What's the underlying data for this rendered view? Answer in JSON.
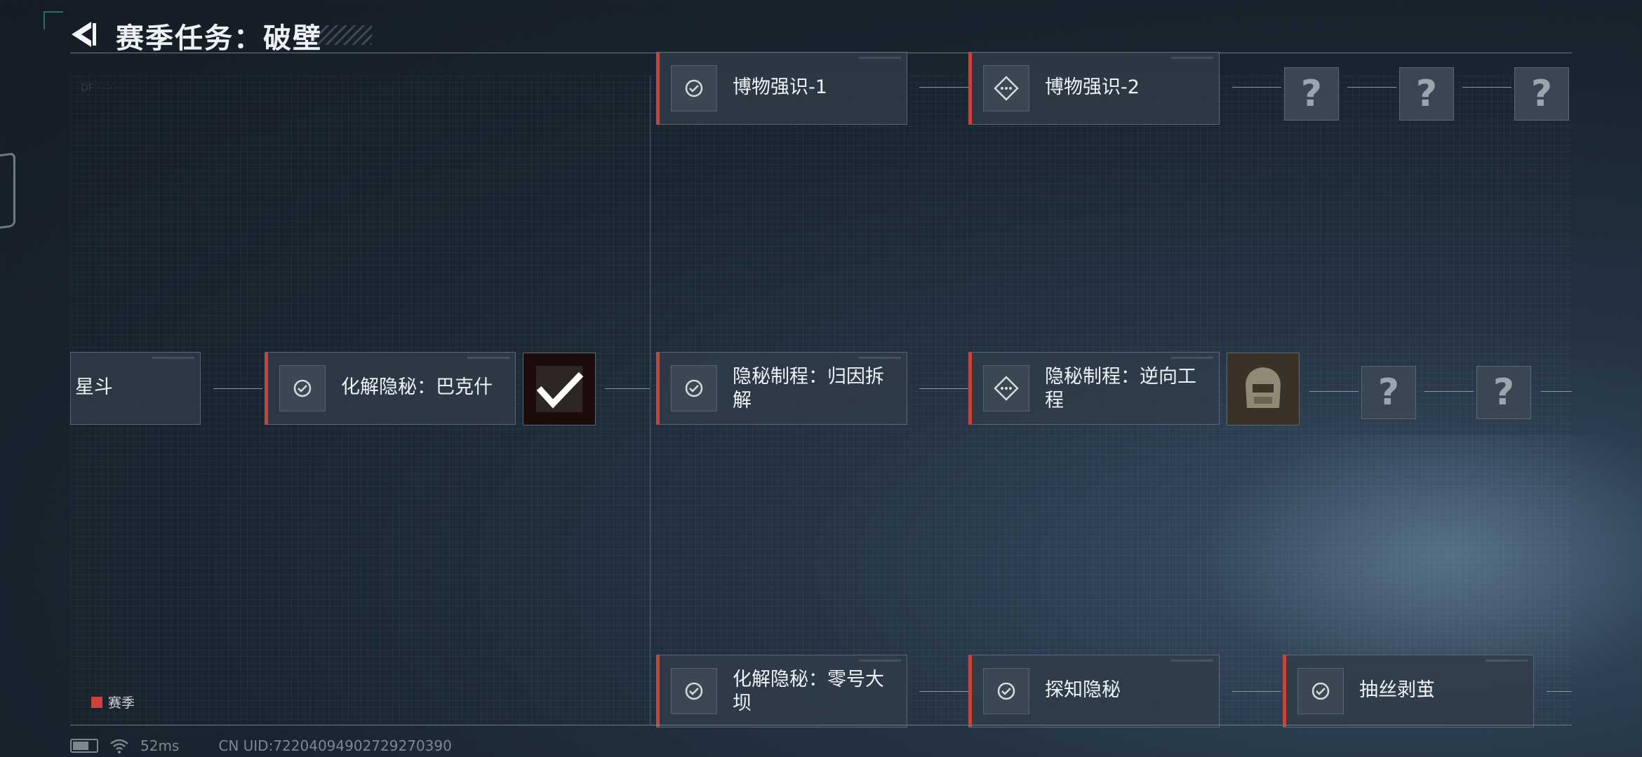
{
  "header": {
    "title": "赛季任务：破壁"
  },
  "nodes": {
    "partial_left": "星斗",
    "huajie_bakeshi": "化解隐秘：巴克什",
    "bowu_1": "博物强识-1",
    "bowu_2": "博物强识-2",
    "guiyin": "隐秘制程：归因拆解",
    "nixiang": "隐秘制程：逆向工程",
    "linghao": "化解隐秘：零号大坝",
    "tanzhi": "探知隐秘",
    "chousi": "抽丝剥茧"
  },
  "unknown_mark": "?",
  "legend": {
    "label": "赛季",
    "color": "#d0413a"
  },
  "status_bar": {
    "ping": "52ms",
    "uid": "CN UID:722040949027292703​90"
  },
  "icons": {
    "back": "back-arrow-icon",
    "medal": "medal-check-icon",
    "diamond": "diamond-dots-icon",
    "battery": "battery-icon",
    "wifi": "wifi-icon"
  },
  "colors": {
    "accent": "#c9433c",
    "background": "#1a2531"
  }
}
